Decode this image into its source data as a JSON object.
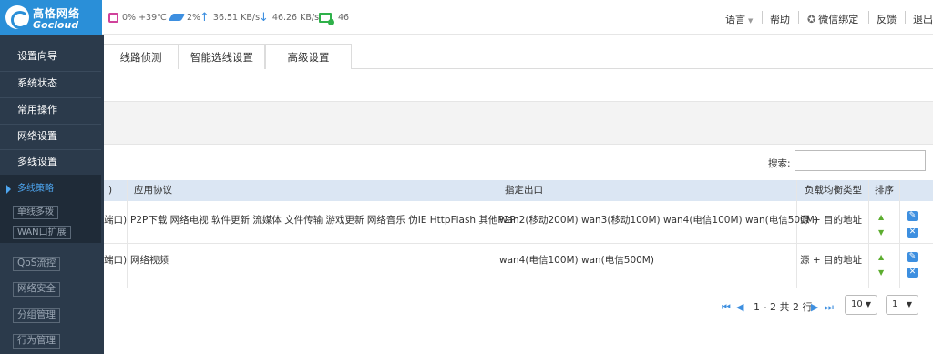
{
  "brand": {
    "name_cn": "高恪网络",
    "name_en": "Gocloud"
  },
  "status": {
    "cpu": "0% +39℃",
    "memory": "2%",
    "upload": "36.51 KB/s",
    "download": "46.26 KB/s",
    "connections": "46"
  },
  "header_links": [
    "语言",
    "帮助",
    "微信绑定",
    "反馈",
    "退出"
  ],
  "sidebar": {
    "items": [
      "设置向导",
      "系统状态",
      "常用操作",
      "网络设置",
      "多线设置"
    ],
    "sub_active": "多线策略",
    "sub_items": [
      "单线多拨",
      "WAN口扩展"
    ],
    "bottom_items": [
      "QoS流控",
      "网络安全",
      "分组管理",
      "行为管理"
    ]
  },
  "tabs": [
    "线路侦测",
    "智能选线设置",
    "高级设置"
  ],
  "search": {
    "label": "搜索:",
    "value": ""
  },
  "table": {
    "headers": {
      "first": ")",
      "protocol": "应用协议",
      "outlet": "指定出口",
      "lb_type": "负载均衡类型",
      "order": "排序"
    },
    "rows": [
      {
        "first": "端口)",
        "protocol": "P2P下载 网络电视 软件更新 流媒体 文件传输 游戏更新 网络音乐 伪IE HttpFlash 其他P2P",
        "outlet": "wan2(移动200M) wan3(移动100M) wan4(电信100M) wan(电信500M)",
        "lb_type": "源 + 目的地址"
      },
      {
        "first": "端口)",
        "protocol": "网络视频",
        "outlet": "wan4(电信100M) wan(电信500M)",
        "lb_type": "源 + 目的地址"
      }
    ]
  },
  "pagination": {
    "info": "1 - 2 共 2 行",
    "page_size": "10",
    "page": "1"
  }
}
